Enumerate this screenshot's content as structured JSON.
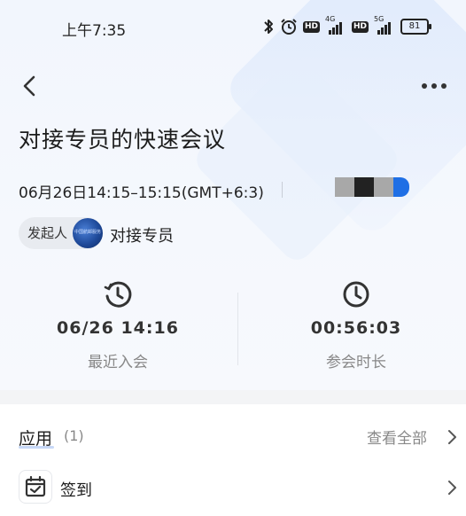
{
  "status_bar": {
    "time": "上午7:35",
    "network_4g": "4G",
    "network_5g": "5G",
    "hd": "HD",
    "battery": "81"
  },
  "meeting": {
    "title": "对接专员的快速会议",
    "datetime": "06月26日14:15–15:15(GMT+6:3)",
    "initiator_label": "发起人",
    "initiator_avatar_text": "中国航邮服务",
    "initiator_name": "对接专员"
  },
  "stats": {
    "recent_join": {
      "value": "06/26 14:16",
      "label": "最近入会",
      "icon": "history-clock-icon"
    },
    "duration": {
      "value": "00:56:03",
      "label": "参会时长",
      "icon": "clock-icon"
    }
  },
  "apps": {
    "title": "应用",
    "count": "(1)",
    "view_all": "查看全部",
    "items": [
      {
        "label": "签到",
        "icon": "calendar-check-icon"
      }
    ]
  },
  "colors": {
    "accent": "#1f6fe5",
    "hero_bg": "#f2f6fd",
    "text_secondary": "#888888",
    "pixel_blocks": [
      "#a8a8a8",
      "#222222",
      "#a8a8a8",
      "#1f6fe5"
    ]
  }
}
